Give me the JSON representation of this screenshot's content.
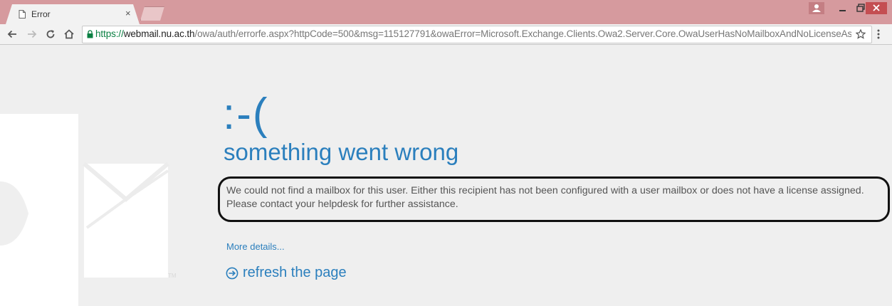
{
  "browser": {
    "tab": {
      "title": "Error",
      "close_glyph": "×"
    },
    "address_bar": {
      "protocol": "https://",
      "host": "webmail.nu.ac.th",
      "path": "/owa/auth/errorfe.aspx?httpCode=500&msg=115127791&owaError=Microsoft.Exchange.Clients.Owa2.Server.Core.OwaUserHasNoMailboxAndNoLicenseAssignedI"
    },
    "icons": {
      "back": "back-arrow-icon",
      "forward": "forward-arrow-icon",
      "reload": "reload-icon",
      "home": "home-icon",
      "lock": "lock-icon",
      "bookmark": "star-icon",
      "menu": "menu-dots-icon"
    }
  },
  "page": {
    "face": ":-(",
    "heading": "something went wrong",
    "message_line1": "We could not find a mailbox for this user. Either this recipient has not been configured with a user mailbox or does not have a license assigned.",
    "message_line2": "Please contact your helpdesk for further assistance.",
    "more_details": "More details...",
    "refresh": "refresh the page"
  },
  "colors": {
    "accent": "#2b7fbd",
    "titlebar": "#d69a9e",
    "close_button": "#c44e52",
    "annotation": "#111111"
  }
}
